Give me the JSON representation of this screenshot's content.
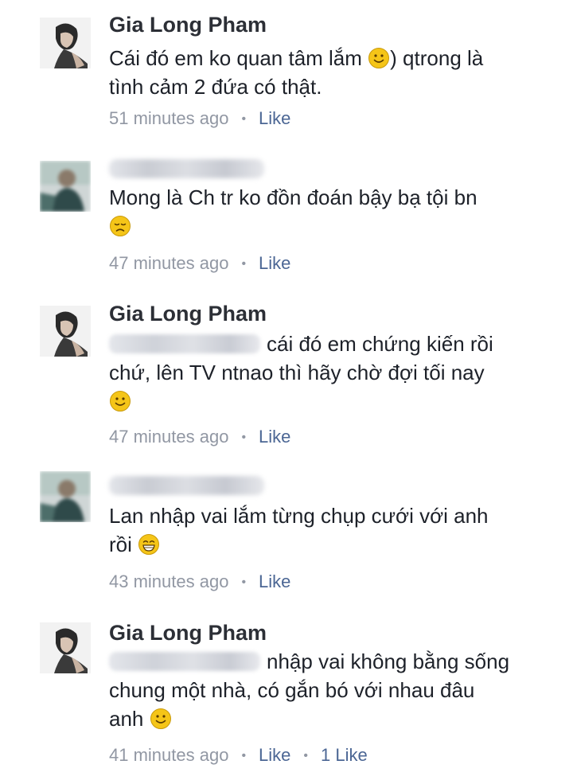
{
  "comments": [
    {
      "author": "Gia Long Pham",
      "text_1": "Cái đó em ko quan tâm lắm",
      "text_2": ") qtrong là",
      "text_3": "tình cảm 2 đứa có thật.",
      "time": "51 minutes ago",
      "like": "Like",
      "emoji": "slight-smile"
    },
    {
      "author_blurred": true,
      "text_1": "Mong là Ch tr ko đồn đoán bậy bạ tội bn",
      "time": "47 minutes ago",
      "like": "Like",
      "emoji": "disappointed-face"
    },
    {
      "author": "Gia Long Pham",
      "text_1": "cái đó em chứng kiến rồi",
      "text_2": "chứ, lên TV ntnao thì hãy chờ đợi tối nay",
      "time": "47 minutes ago",
      "like": "Like",
      "emoji": "slight-smile"
    },
    {
      "author_blurred": true,
      "text_1": "Lan nhập vai lắm từng chụp cưới với anh",
      "text_2": "rồi",
      "time": "43 minutes ago",
      "like": "Like",
      "emoji": "grinning-face"
    },
    {
      "author": "Gia Long Pham",
      "text_1": "nhập vai không bằng sống",
      "text_2": "chung một nhà, có gắn bó với nhau đâu",
      "text_3": "anh",
      "time": "41 minutes ago",
      "like": "Like",
      "like_count": "1 Like",
      "emoji": "slight-smile"
    }
  ],
  "colors": {
    "author": "#2c2f36",
    "text": "#1d2129",
    "meta": "#9197a3",
    "like": "#4b6694",
    "emoji": "#f5c518"
  }
}
